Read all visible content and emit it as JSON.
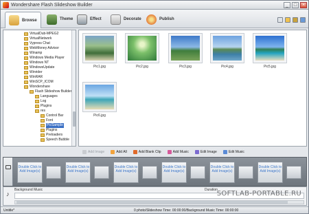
{
  "window": {
    "title": "Wondershare Flash Slideshow Builder",
    "minimize": "_",
    "maximize": "□",
    "close": "×"
  },
  "tabs": [
    {
      "label": "Browse",
      "icon": "folder-icon",
      "active": true
    },
    {
      "label": "Theme",
      "icon": "theme-icon"
    },
    {
      "label": "Effect",
      "icon": "effect-icon"
    },
    {
      "label": "Decorate",
      "icon": "decorate-icon"
    },
    {
      "label": "Publish",
      "icon": "publish-icon"
    }
  ],
  "tree": {
    "items": [
      "VirtualDub-MPEG2",
      "VirtualNetwork",
      "Vypress Chat",
      "WebMoney Advisor",
      "Winamp",
      "Windows Media Player",
      "Windows NT",
      "WindowsUpdate",
      "Winrider",
      "WinRAR",
      "WinSCP_ICOM",
      "Wondershare",
      "Flash Slideshow Builder",
      "Languages",
      "Log",
      "Plugins",
      "res",
      "Control Bar",
      "Font",
      "PicSample",
      "Plugins",
      "Preloaders",
      "Speech Bubble"
    ],
    "selected": "PicSample"
  },
  "thumbnails": [
    {
      "name": "Pic1.jpg"
    },
    {
      "name": "Pic2.jpg"
    },
    {
      "name": "Pic3.jpg"
    },
    {
      "name": "Pic4.jpg"
    },
    {
      "name": "Pic5.jpg"
    },
    {
      "name": "Pic6.jpg"
    }
  ],
  "actions": {
    "add_image": "Add Image",
    "add_all": "Add All",
    "add_blank_clip": "Add Blank Clip",
    "add_music": "Add Music",
    "edit_image": "Edit Image",
    "edit_music": "Edit Music"
  },
  "storyboard": {
    "slot_text": "Double Click to Add Image(s)"
  },
  "music": {
    "label": "Background Music",
    "duration_label": "Duration"
  },
  "status": {
    "project": "Untitle*",
    "info": "0 photo/Slideshow Time: 00:00:00/Background Music Time: 00:00:00"
  },
  "watermark": "SOFTLAB-PORTABLE.RU"
}
